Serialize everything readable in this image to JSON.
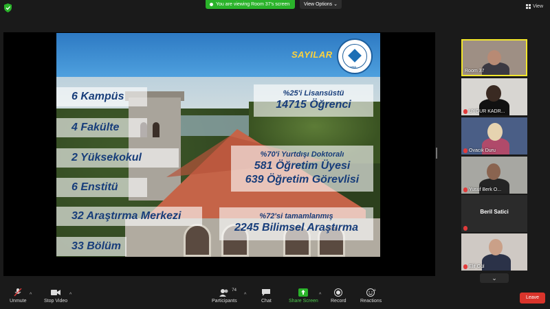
{
  "top_bar": {
    "viewing_label": "You are viewing Room 37's screen",
    "view_options_label": "View Options",
    "view_label": "View",
    "brand_color": "#2ab32a"
  },
  "slide": {
    "title": "SAYILAR",
    "seal_year": "1863",
    "left_items": [
      "6 Kampüs",
      "4 Fakülte",
      "2 Yüksekokul",
      "6 Enstitü",
      "32 Araştırma Merkezi",
      "33 Bölüm"
    ],
    "right_blocks": [
      {
        "small": "%25'i Lisansüstü",
        "big": "14715 Öğrenci"
      },
      {
        "small": "%70'i Yurtdışı Doktoralı",
        "big": "581 Öğretim Üyesi",
        "big2": "639 Öğretim Görevlisi"
      },
      {
        "small": "%72'si tamamlanmış",
        "big": "2245 Bilimsel Araştırma"
      }
    ]
  },
  "participants_panel": {
    "tiles": [
      {
        "name": "Room 37"
      },
      {
        "name": "UYGUR KADR..."
      },
      {
        "name": "Ovacık Duru"
      },
      {
        "name": "Yusuf Berk O..."
      },
      {
        "name": "Beril Satici"
      },
      {
        "name": "Elif Gül"
      }
    ],
    "scroll_icon": "chevron-down-icon"
  },
  "toolbar": {
    "unmute": "Unmute",
    "stop_video": "Stop Video",
    "participants": "Participants",
    "participants_count": "74",
    "chat": "Chat",
    "share_screen": "Share Screen",
    "record": "Record",
    "reactions": "Reactions",
    "leave": "Leave",
    "leave_color": "#d9342b",
    "share_color": "#2ab32a"
  }
}
